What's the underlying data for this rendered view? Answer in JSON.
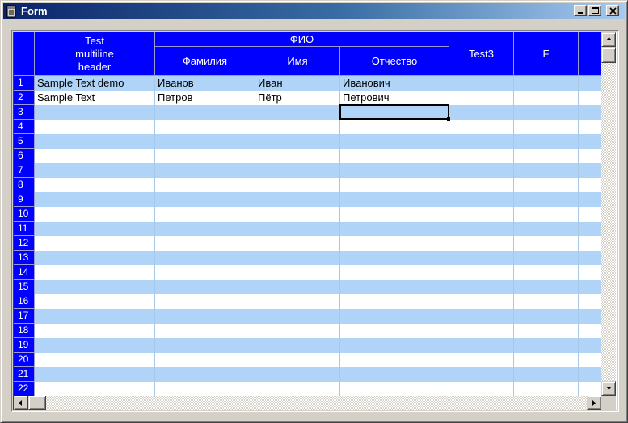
{
  "window": {
    "title": "Form"
  },
  "colors": {
    "header_bg": "#0000ff",
    "row_alt": "#b0d4f8",
    "row_plain": "#ffffff",
    "title_start": "#0a246a",
    "title_end": "#a6caf0"
  },
  "headers": {
    "col1": "Test\nmultiline\nheader",
    "group": "ФИО",
    "familia": "Фамилия",
    "imya": "Имя",
    "otchestvo": "Отчество",
    "test3": "Test3",
    "f": "F"
  },
  "rows": [
    {
      "num": "1",
      "cells": [
        "Sample Text demo",
        "Иванов",
        "Иван",
        "Иванович",
        "",
        "",
        ""
      ]
    },
    {
      "num": "2",
      "cells": [
        "Sample Text",
        "Петров",
        "Пётр",
        "Петрович",
        "",
        "",
        ""
      ]
    },
    {
      "num": "3",
      "cells": [
        "",
        "",
        "",
        "",
        "",
        "",
        ""
      ]
    },
    {
      "num": "4",
      "cells": [
        "",
        "",
        "",
        "",
        "",
        "",
        ""
      ]
    },
    {
      "num": "5",
      "cells": [
        "",
        "",
        "",
        "",
        "",
        "",
        ""
      ]
    },
    {
      "num": "6",
      "cells": [
        "",
        "",
        "",
        "",
        "",
        "",
        ""
      ]
    },
    {
      "num": "7",
      "cells": [
        "",
        "",
        "",
        "",
        "",
        "",
        ""
      ]
    },
    {
      "num": "8",
      "cells": [
        "",
        "",
        "",
        "",
        "",
        "",
        ""
      ]
    },
    {
      "num": "9",
      "cells": [
        "",
        "",
        "",
        "",
        "",
        "",
        ""
      ]
    },
    {
      "num": "10",
      "cells": [
        "",
        "",
        "",
        "",
        "",
        "",
        ""
      ]
    },
    {
      "num": "11",
      "cells": [
        "",
        "",
        "",
        "",
        "",
        "",
        ""
      ]
    },
    {
      "num": "12",
      "cells": [
        "",
        "",
        "",
        "",
        "",
        "",
        ""
      ]
    },
    {
      "num": "13",
      "cells": [
        "",
        "",
        "",
        "",
        "",
        "",
        ""
      ]
    },
    {
      "num": "14",
      "cells": [
        "",
        "",
        "",
        "",
        "",
        "",
        ""
      ]
    },
    {
      "num": "15",
      "cells": [
        "",
        "",
        "",
        "",
        "",
        "",
        ""
      ]
    },
    {
      "num": "16",
      "cells": [
        "",
        "",
        "",
        "",
        "",
        "",
        ""
      ]
    },
    {
      "num": "17",
      "cells": [
        "",
        "",
        "",
        "",
        "",
        "",
        ""
      ]
    },
    {
      "num": "18",
      "cells": [
        "",
        "",
        "",
        "",
        "",
        "",
        ""
      ]
    },
    {
      "num": "19",
      "cells": [
        "",
        "",
        "",
        "",
        "",
        "",
        ""
      ]
    },
    {
      "num": "20",
      "cells": [
        "",
        "",
        "",
        "",
        "",
        "",
        ""
      ]
    },
    {
      "num": "21",
      "cells": [
        "",
        "",
        "",
        "",
        "",
        "",
        ""
      ]
    },
    {
      "num": "22",
      "cells": [
        "",
        "",
        "",
        "",
        "",
        "",
        ""
      ]
    }
  ],
  "focus": {
    "row": 3,
    "col": 4
  }
}
